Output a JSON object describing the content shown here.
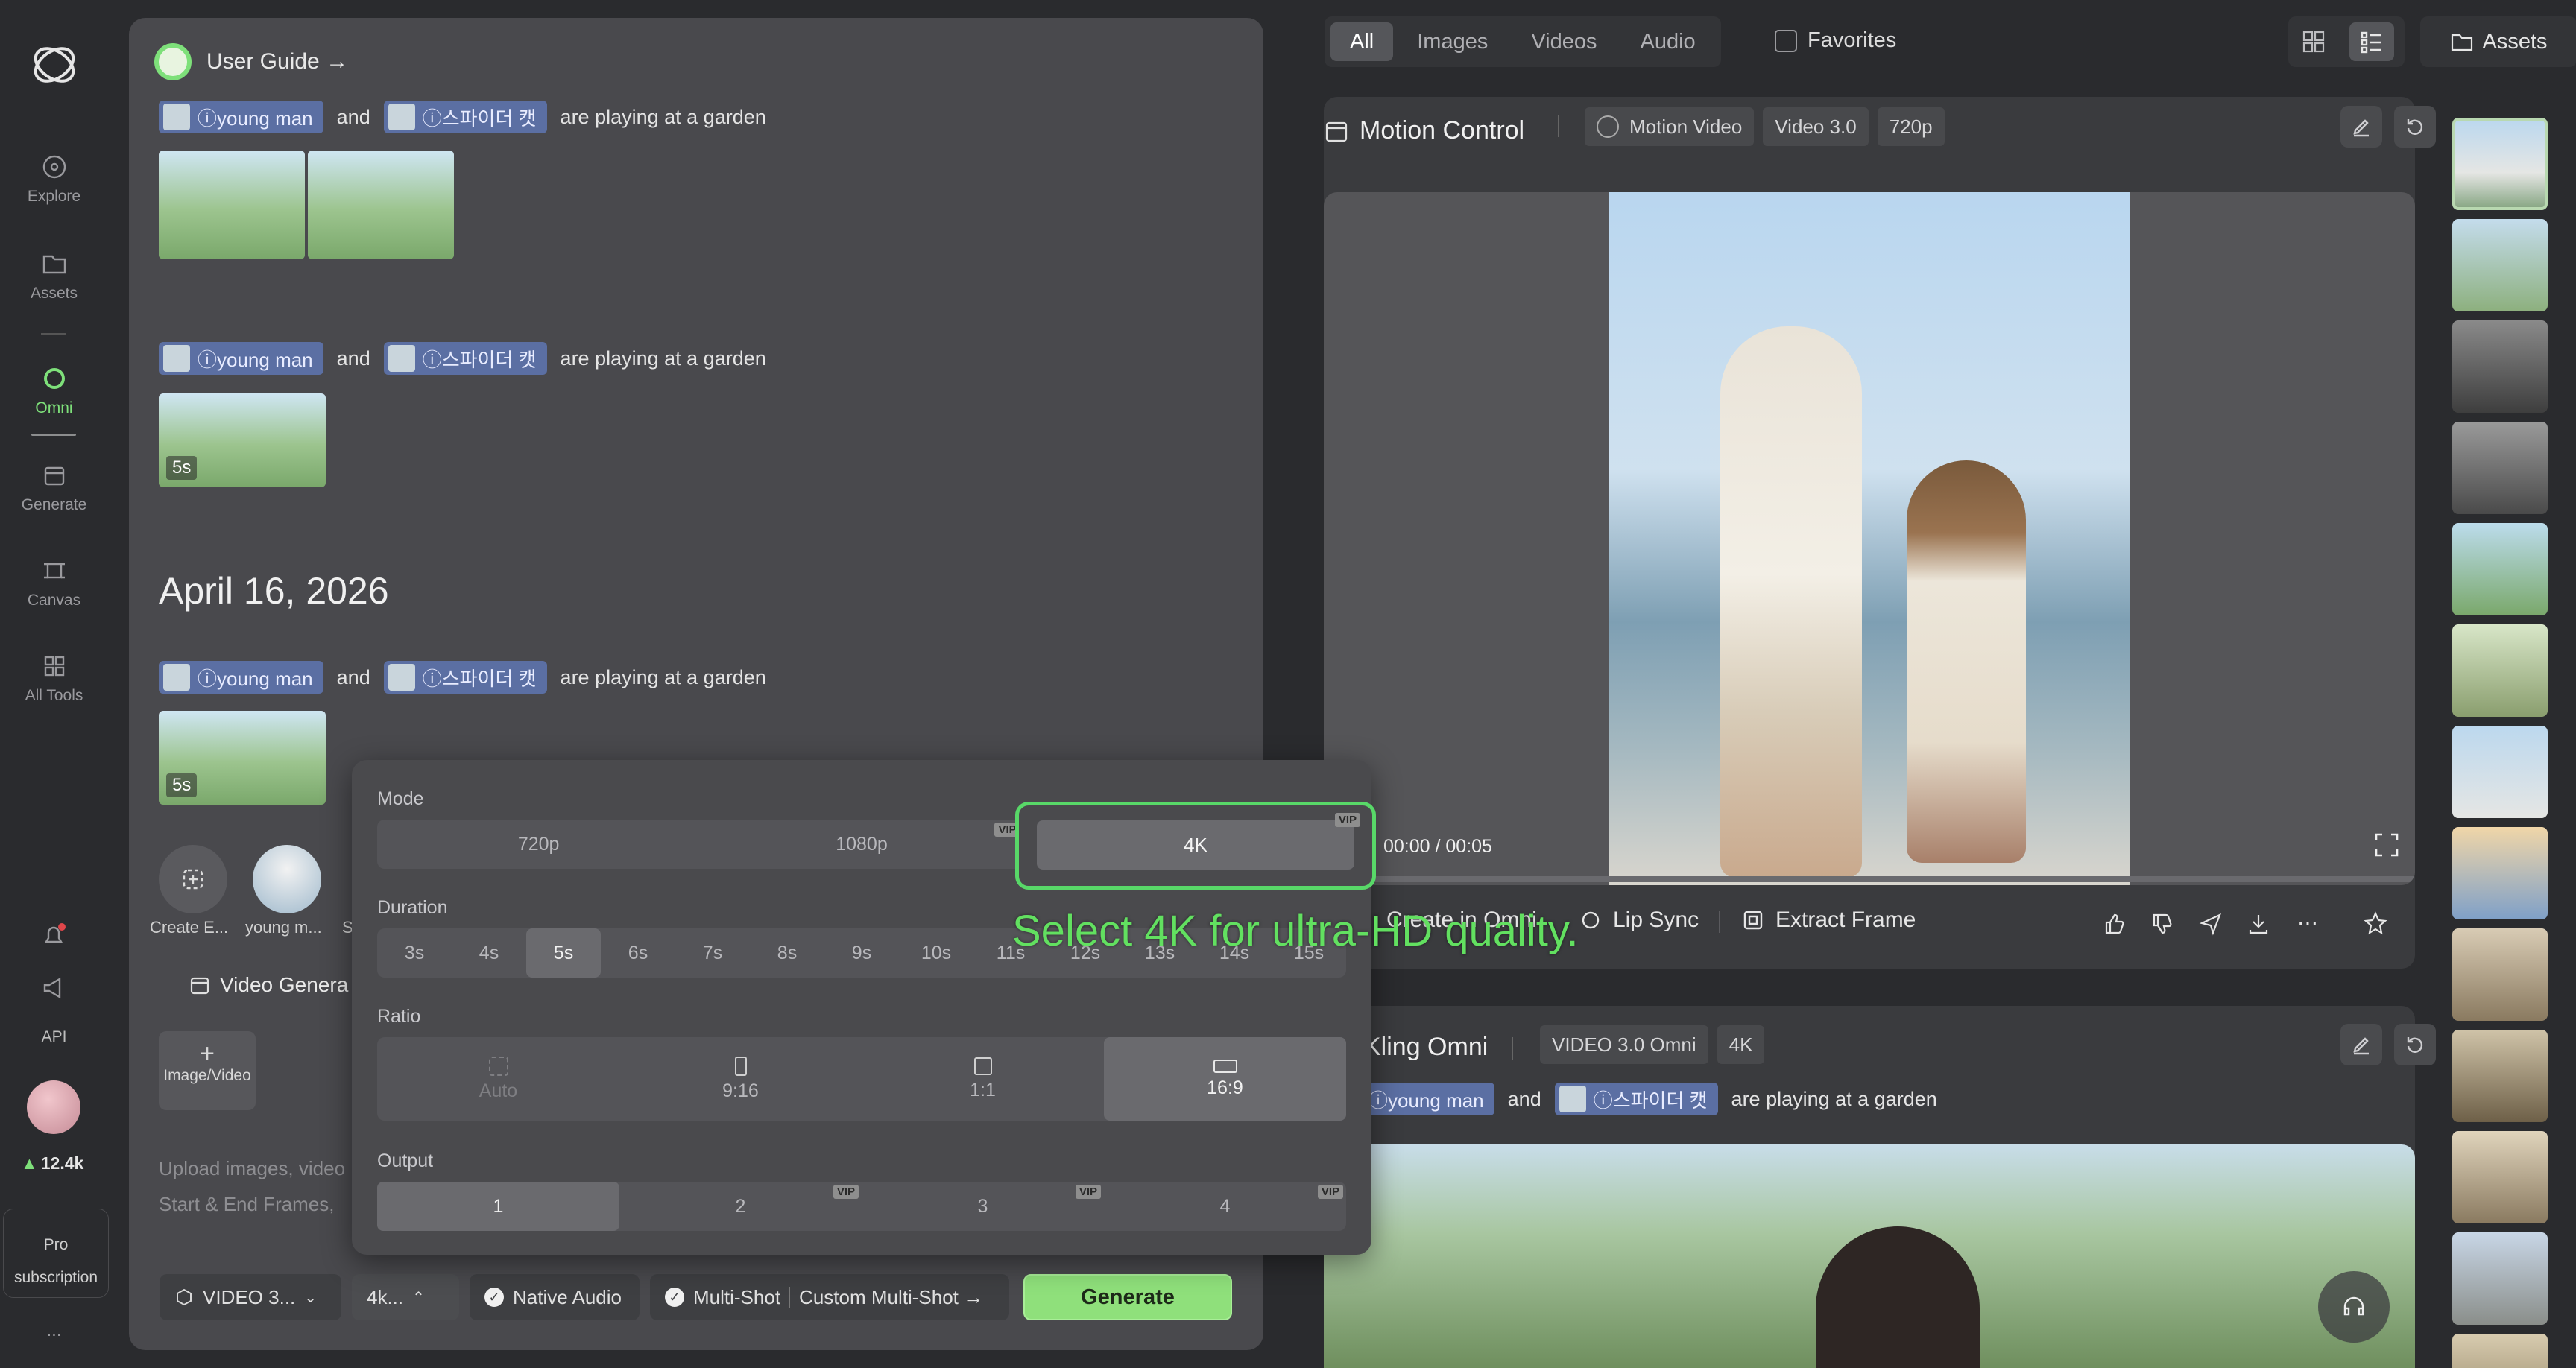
{
  "sidebar": {
    "items": [
      {
        "label": "Explore",
        "icon": "explore-icon"
      },
      {
        "label": "Assets",
        "icon": "folder-icon"
      },
      {
        "label": "Omni",
        "icon": "omni-icon"
      },
      {
        "label": "Generate",
        "icon": "generate-icon"
      },
      {
        "label": "Canvas",
        "icon": "canvas-icon"
      },
      {
        "label": "All Tools",
        "icon": "grid-icon"
      }
    ],
    "api_label": "API",
    "credits": "12.4k",
    "pro_label": "Pro",
    "subscription_label": "subscription",
    "more": "..."
  },
  "guide": {
    "label": "User Guide →"
  },
  "history": {
    "chip1": "ⓘyoung man",
    "and": "and",
    "chip2": "ⓘ스파이더 캣",
    "prompt_tail": "are playing at a garden",
    "badge": "5s",
    "date": "April 16, 2026"
  },
  "shortcuts": {
    "create_label": "Create E...",
    "avatar_label": "young m...",
    "s_label": "S"
  },
  "composer": {
    "video_gen_label": "Video Genera",
    "add_media_label": "Image/Video",
    "placeholder_line1": "Upload images, video",
    "placeholder_line2": "Start & End Frames,"
  },
  "popup": {
    "mode_label": "Mode",
    "modes": [
      "720p",
      "1080p",
      "4K"
    ],
    "duration_label": "Duration",
    "durations": [
      "3s",
      "4s",
      "5s",
      "6s",
      "7s",
      "8s",
      "9s",
      "10s",
      "11s",
      "12s",
      "13s",
      "14s",
      "15s"
    ],
    "ratio_label": "Ratio",
    "ratios": [
      "Auto",
      "9:16",
      "1:1",
      "16:9"
    ],
    "output_label": "Output",
    "outputs": [
      "1",
      "2",
      "3",
      "4"
    ],
    "vip": "VIP",
    "hint": "Select 4K for ultra-HD quality."
  },
  "toolbar": {
    "model": "VIDEO 3...",
    "quality": "4k...",
    "native_audio": "Native Audio",
    "multi_shot": "Multi-Shot",
    "custom_multi_shot": "Custom Multi-Shot →",
    "generate": "Generate"
  },
  "filters": {
    "tabs": [
      "All",
      "Images",
      "Videos",
      "Audio"
    ],
    "favorites": "Favorites",
    "assets": "Assets"
  },
  "card1": {
    "title": "Motion Control",
    "tags": [
      "Motion Video",
      "Video 3.0",
      "720p"
    ],
    "time": "00:00 / 00:05",
    "create_in_omni": "Create in Omni",
    "lip_sync": "Lip Sync",
    "extract_frame": "Extract Frame"
  },
  "card2": {
    "title": "Kling Omni",
    "tags": [
      "VIDEO 3.0 Omni",
      "4K"
    ],
    "chip1": "ⓘyoung man",
    "and": "and",
    "chip2": "ⓘ스파이더 캣",
    "prompt_tail": "are playing at a garden"
  },
  "colors": {
    "accent": "#7ee07a",
    "chip": "#5b6fa3",
    "generate": "#8fe07b"
  }
}
